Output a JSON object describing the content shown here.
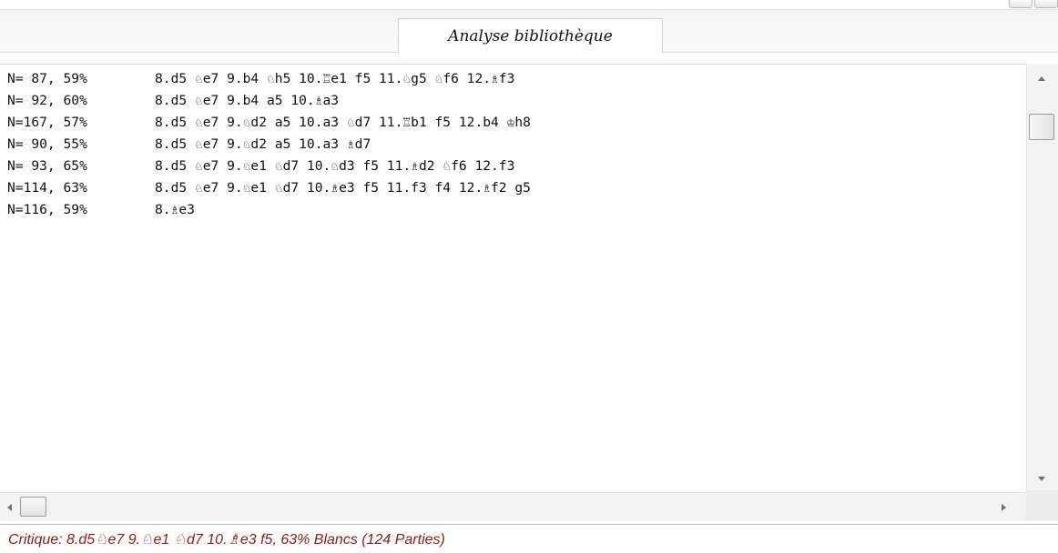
{
  "tab": {
    "label": "Analyse bibliothèque"
  },
  "analysis_lines": [
    {
      "stat": "N= 87, 59%",
      "moves": "8.d5 ♘e7 9.b4 ♘h5 10.♖e1 f5 11.♘g5 ♘f6 12.♗f3"
    },
    {
      "stat": "N= 92, 60%",
      "moves": "8.d5 ♘e7 9.b4 a5 10.♗a3"
    },
    {
      "stat": "N=167, 57%",
      "moves": "8.d5 ♘e7 9.♘d2 a5 10.a3 ♘d7 11.♖b1 f5 12.b4 ♔h8"
    },
    {
      "stat": "N= 90, 55%",
      "moves": "8.d5 ♘e7 9.♘d2 a5 10.a3 ♗d7"
    },
    {
      "stat": "N= 93, 65%",
      "moves": "8.d5 ♘e7 9.♘e1 ♘d7 10.♘d3 f5 11.♗d2 ♘f6 12.f3"
    },
    {
      "stat": "N=114, 63%",
      "moves": "8.d5 ♘e7 9.♘e1 ♘d7 10.♗e3 f5 11.f3 f4 12.♗f2 g5"
    },
    {
      "stat": "N=116, 59%",
      "moves": "8.♗e3"
    }
  ],
  "status": {
    "text": "Critique: 8.d5♘e7 9.♘e1 ♘d7 10.♗e3 f5, 63% Blancs (124 Parties)"
  },
  "icons": {
    "scroll_up": "arrow-up-icon",
    "scroll_down": "arrow-down-icon",
    "scroll_left": "arrow-left-icon",
    "scroll_right": "arrow-right-icon"
  },
  "colors": {
    "status_text": "#8b1c1c",
    "background": "#ffffff"
  }
}
